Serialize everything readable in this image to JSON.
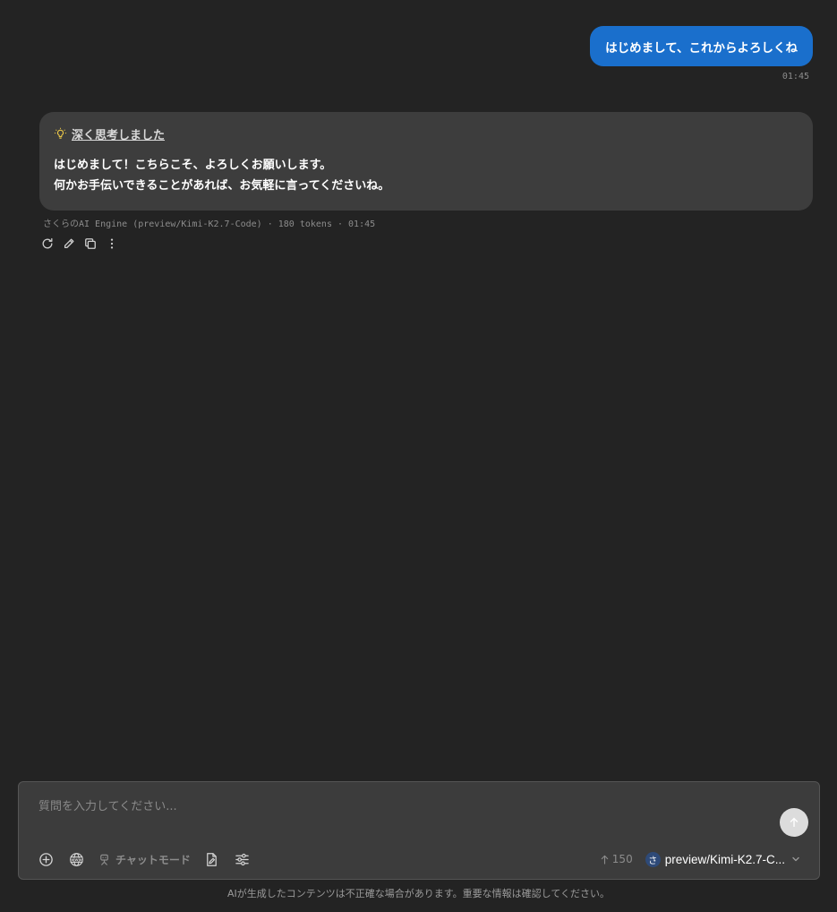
{
  "user_message": {
    "text": "はじめまして、これからよろしくね",
    "time": "01:45"
  },
  "assistant_message": {
    "thought_label": "深く思考しました",
    "lines": [
      "はじめまして！こちらこそ、よろしくお願いします。",
      "何かお手伝いできることがあれば、お気軽に言ってくださいね。"
    ],
    "meta": "さくらのAI Engine (preview/Kimi-K2.7-Code) · 180 tokens · 01:45",
    "actions": [
      "refresh-icon",
      "pencil-icon",
      "copy-icon",
      "more-vertical-icon"
    ]
  },
  "composer": {
    "placeholder": "質問を入力してください...",
    "chat_mode_label": "チャットモード",
    "token_count": "150",
    "model_avatar": "さ",
    "model_name": "preview/Kimi-K2.7-C..."
  },
  "disclaimer": "AIが生成したコンテンツは不正確な場合があります。重要な情報は確認してください。",
  "colors": {
    "background": "#232323",
    "user_bubble": "#1a6fcc",
    "assistant_bubble": "#3d3d3d",
    "composer": "#3c3c3c",
    "bulb": "#e8c547"
  }
}
